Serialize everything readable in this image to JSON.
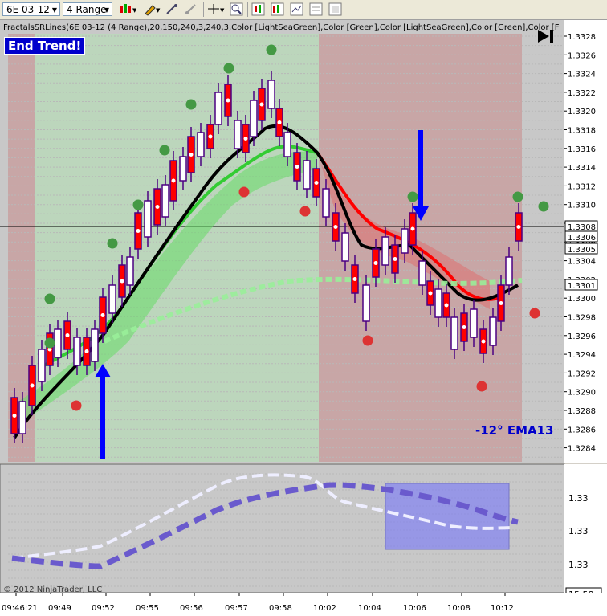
{
  "toolbar": {
    "instrument": "6E 03-12",
    "period": "4 Range"
  },
  "indicator_params": "FractalsSRLines(6E 03-12 (4 Range),20,150,240,3,240,3,Color [LightSeaGreen],Color [Green],Color [LightSeaGreen],Color [Green],Color [F",
  "end_trend_label": "End Trend!",
  "ema_annotation": "-12° EMA13",
  "price_axis": {
    "ticks": [
      "1.3328",
      "1.3326",
      "1.3324",
      "1.3322",
      "1.3320",
      "1.3318",
      "1.3316",
      "1.3314",
      "1.3312",
      "1.3310",
      "1.3308",
      "1.3306",
      "1.3304",
      "1.3302",
      "1.3300",
      "1.3298",
      "1.3296",
      "1.3294",
      "1.3292",
      "1.3290",
      "1.3288",
      "1.3286",
      "1.3284"
    ],
    "price_markers": [
      "1.3308",
      "1.3306",
      "1.3305",
      "1.3301"
    ]
  },
  "lower_axis": {
    "ticks": [
      "1.33",
      "1.33",
      "1.33"
    ],
    "current_value": "15.58"
  },
  "time_axis": {
    "ticks": [
      "09:46:21",
      "09:49",
      "09:52",
      "09:55",
      "09:56",
      "09:57",
      "09:58",
      "10:02",
      "10:04",
      "10:06",
      "10:08",
      "10:12"
    ]
  },
  "copyright": "© 2012 NinjaTrader, LLC",
  "colors": {
    "green_zone": "#bcd6bc",
    "red_zone": "#c8a6a6",
    "blue_arrow": "#0000ff",
    "ema_green": "#33cc33",
    "ema_red": "#ff0000"
  }
}
